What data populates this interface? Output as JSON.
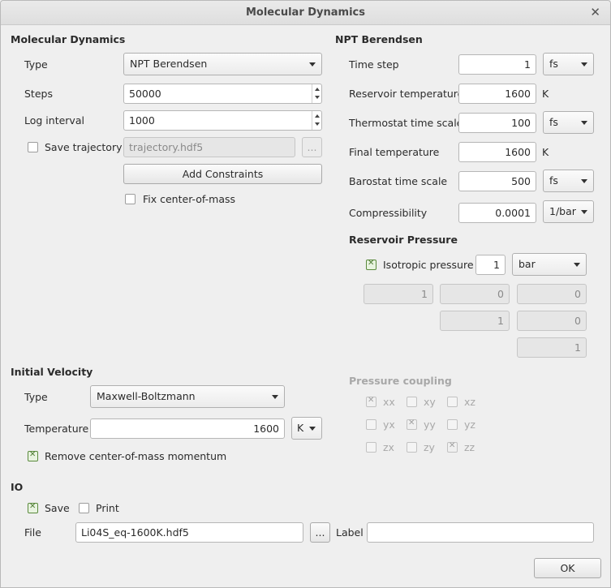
{
  "window": {
    "title": "Molecular Dynamics",
    "close_label": "✕"
  },
  "md": {
    "header": "Molecular Dynamics",
    "type_label": "Type",
    "type_value": "NPT Berendsen",
    "steps_label": "Steps",
    "steps_value": "50000",
    "log_label": "Log interval",
    "log_value": "1000",
    "save_traj_label": "Save trajectory",
    "save_traj_checked": false,
    "traj_file": "trajectory.hdf5",
    "browse_label": "...",
    "add_constraints_label": "Add Constraints",
    "fix_com_label": "Fix center-of-mass",
    "fix_com_checked": false
  },
  "npt": {
    "header": "NPT Berendsen",
    "time_step_label": "Time step",
    "time_step_value": "1",
    "time_step_unit": "fs",
    "res_temp_label": "Reservoir temperature",
    "res_temp_value": "1600",
    "res_temp_unit": "K",
    "thermo_label": "Thermostat time scale",
    "thermo_value": "100",
    "thermo_unit": "fs",
    "final_temp_label": "Final temperature",
    "final_temp_value": "1600",
    "final_temp_unit": "K",
    "baro_label": "Barostat time scale",
    "baro_value": "500",
    "baro_unit": "fs",
    "compress_label": "Compressibility",
    "compress_value": "0.0001",
    "compress_unit": "1/bar"
  },
  "pressure": {
    "header": "Reservoir Pressure",
    "isotropic_label": "Isotropic pressure",
    "isotropic_checked": true,
    "iso_value": "1",
    "iso_unit": "bar",
    "matrix": [
      "1",
      "0",
      "0",
      "1",
      "0",
      "1"
    ],
    "coupling_header": "Pressure coupling",
    "coupling": [
      {
        "label": "xx",
        "checked": true
      },
      {
        "label": "xy",
        "checked": false
      },
      {
        "label": "xz",
        "checked": false
      },
      {
        "label": "yx",
        "checked": false
      },
      {
        "label": "yy",
        "checked": true
      },
      {
        "label": "yz",
        "checked": false
      },
      {
        "label": "zx",
        "checked": false
      },
      {
        "label": "zy",
        "checked": false
      },
      {
        "label": "zz",
        "checked": true
      }
    ]
  },
  "velocity": {
    "header": "Initial Velocity",
    "type_label": "Type",
    "type_value": "Maxwell-Boltzmann",
    "temp_label": "Temperature",
    "temp_value": "1600",
    "temp_unit": "K",
    "remove_com_label": "Remove center-of-mass momentum",
    "remove_com_checked": true
  },
  "io": {
    "header": "IO",
    "save_label": "Save",
    "save_checked": true,
    "print_label": "Print",
    "print_checked": false,
    "file_label": "File",
    "file_value": "Li04S_eq-1600K.hdf5",
    "browse_label": "...",
    "label_label": "Label",
    "label_value": ""
  },
  "ok_label": "OK"
}
